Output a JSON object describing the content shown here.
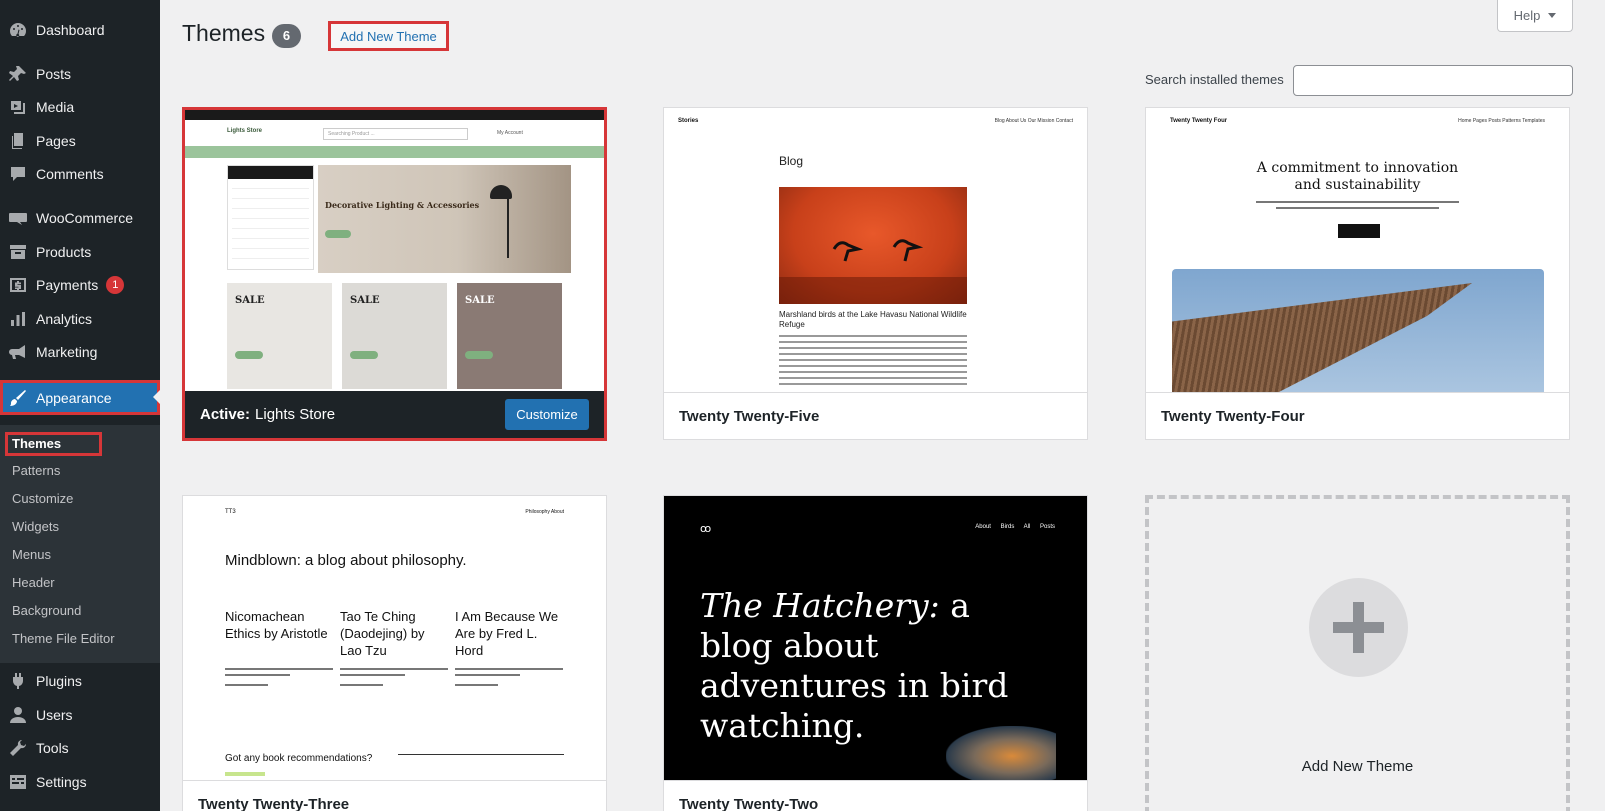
{
  "sidebar": {
    "menu": [
      {
        "key": "dashboard",
        "label": "Dashboard",
        "icon": "dashboard-icon"
      },
      {
        "key": "posts",
        "label": "Posts",
        "icon": "pin-icon"
      },
      {
        "key": "media",
        "label": "Media",
        "icon": "media-icon"
      },
      {
        "key": "pages",
        "label": "Pages",
        "icon": "pages-icon"
      },
      {
        "key": "comments",
        "label": "Comments",
        "icon": "comment-icon"
      },
      {
        "key": "woocommerce",
        "label": "WooCommerce",
        "icon": "woo-icon"
      },
      {
        "key": "products",
        "label": "Products",
        "icon": "archive-icon"
      },
      {
        "key": "payments",
        "label": "Payments",
        "icon": "dollar-icon",
        "badge": "1"
      },
      {
        "key": "analytics",
        "label": "Analytics",
        "icon": "chart-bar-icon"
      },
      {
        "key": "marketing",
        "label": "Marketing",
        "icon": "megaphone-icon"
      },
      {
        "key": "appearance",
        "label": "Appearance",
        "icon": "paintbrush-icon"
      },
      {
        "key": "plugins",
        "label": "Plugins",
        "icon": "plugin-icon"
      },
      {
        "key": "users",
        "label": "Users",
        "icon": "user-icon"
      },
      {
        "key": "tools",
        "label": "Tools",
        "icon": "wrench-icon"
      },
      {
        "key": "settings",
        "label": "Settings",
        "icon": "settings-icon"
      }
    ],
    "appearance_submenu": [
      "Themes",
      "Patterns",
      "Customize",
      "Widgets",
      "Menus",
      "Header",
      "Background",
      "Theme File Editor"
    ],
    "badge_color": "#d63638",
    "current_color": "#2271b1"
  },
  "header": {
    "title": "Themes",
    "count": "6",
    "add_new_label": "Add New Theme",
    "help_label": "Help"
  },
  "search": {
    "label": "Search installed themes",
    "value": ""
  },
  "themes": {
    "active": {
      "prefix": "Active:",
      "name": "Lights Store",
      "customize_label": "Customize",
      "preview": {
        "logo": "Lights Store",
        "search_placeholder": "Searching Product ...",
        "account": "My Account",
        "hero_title": "Decorative Lighting & Accessories",
        "sale_label": "SALE"
      }
    },
    "t25": {
      "name": "Twenty Twenty-Five",
      "preview": {
        "site": "Stories",
        "links": "Blog   About Us   Our Mission   Contact",
        "heading": "Blog",
        "caption": "Marshland birds at the Lake Havasu National Wildlife Refuge"
      }
    },
    "t24": {
      "name": "Twenty Twenty-Four",
      "preview": {
        "site": "Twenty Twenty Four",
        "links": "Home   Pages   Posts   Patterns   Templates",
        "heading": "A commitment to innovation and sustainability"
      }
    },
    "t23": {
      "name": "Twenty Twenty-Three",
      "preview": {
        "site": "TT3",
        "links": "Philosophy   About",
        "heading": "Mindblown: a blog about philosophy.",
        "col1": "Nicomachean Ethics by Aristotle",
        "col2": "Tao Te Ching (Daodejing) by Lao Tzu",
        "col3": "I Am Because We Are by Fred L. Hord",
        "footer": "Got any book recommendations?"
      }
    },
    "t22": {
      "name": "Twenty Twenty-Two",
      "preview": {
        "logo": "ꝏ",
        "links": "About Birds All Posts",
        "heading_em": "The Hatchery:",
        "heading_rest": " a blog about adventures in bird watching."
      }
    },
    "add_new": {
      "label": "Add New Theme"
    }
  }
}
